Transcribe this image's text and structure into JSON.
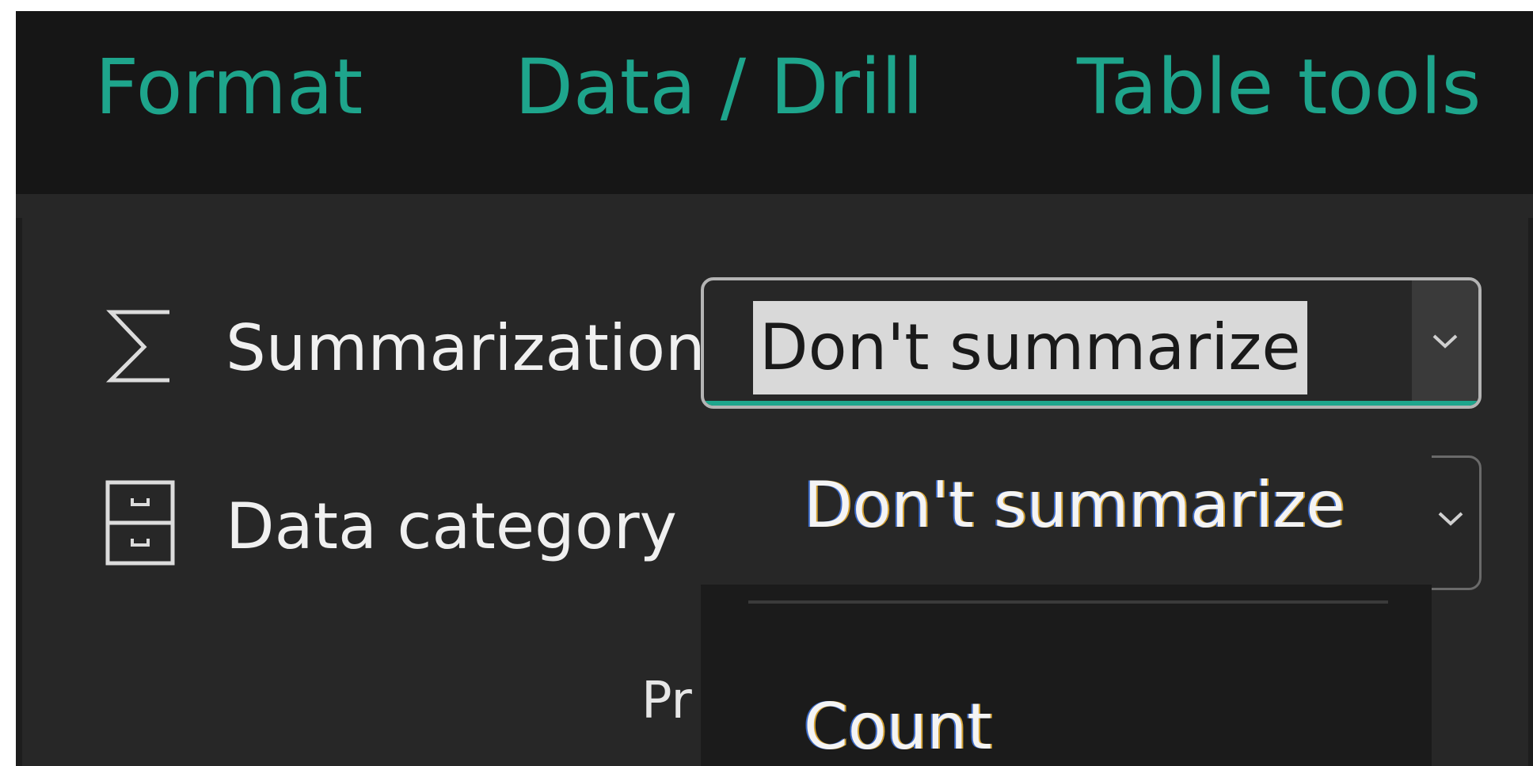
{
  "ribbon": {
    "tabs": [
      {
        "label": "Format"
      },
      {
        "label": "Data / Drill"
      },
      {
        "label": "Table tools"
      }
    ]
  },
  "properties": {
    "summarization": {
      "label": "Summarization",
      "icon": "sigma-icon",
      "selected_value": "Don't summarize"
    },
    "data_category": {
      "label": "Data category",
      "icon": "category-icon"
    },
    "partially_hidden_label": "Pr"
  },
  "dropdown": {
    "options": [
      {
        "label": "Don't summarize"
      },
      {
        "label": "Count"
      }
    ]
  },
  "colors": {
    "accent": "#1ea58c",
    "ribbon_background": "#161616",
    "panel_background": "#272727",
    "menu_background": "#1b1b1b"
  }
}
